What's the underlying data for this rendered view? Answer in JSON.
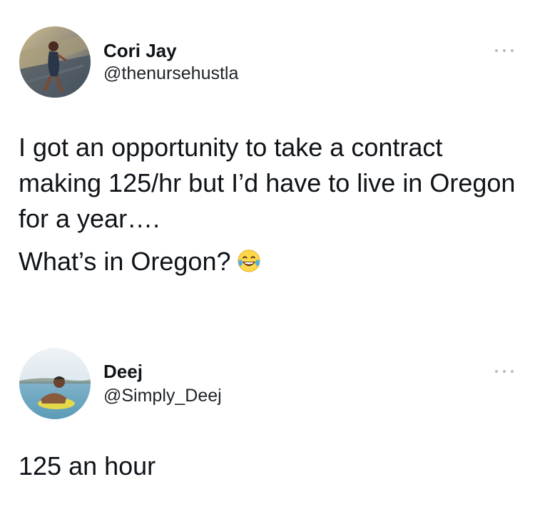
{
  "tweets": [
    {
      "author": {
        "name": "Cori Jay",
        "handle": "@thenursehustla"
      },
      "text_paragraphs": [
        "I got an opportunity to take a contract making 125/hr but I’d have to live in Oregon for a year….",
        "What’s in Oregon?"
      ],
      "emoji": "face-with-tears-of-joy"
    },
    {
      "author": {
        "name": "Deej",
        "handle": "@Simply_Deej"
      },
      "text_paragraphs": [
        "125 an hour"
      ]
    }
  ],
  "icons": {
    "more": "more-horizontal-icon"
  },
  "colors": {
    "text": "#0f1419",
    "muted": "#b8bcc0"
  }
}
